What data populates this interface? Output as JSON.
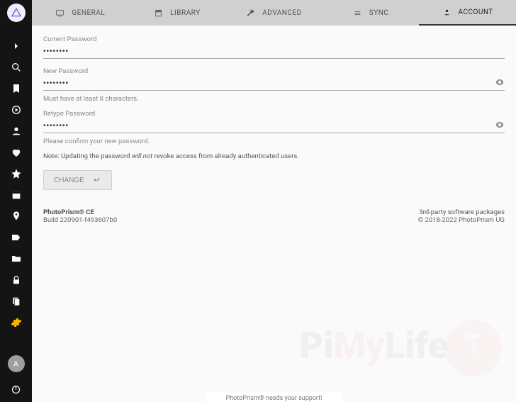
{
  "sidebar": {
    "items": [
      {
        "name": "expand-icon"
      },
      {
        "name": "search-icon"
      },
      {
        "name": "bookmark-icon"
      },
      {
        "name": "play-icon"
      },
      {
        "name": "person-icon"
      },
      {
        "name": "heart-icon"
      },
      {
        "name": "star-icon"
      },
      {
        "name": "calendar-icon"
      },
      {
        "name": "place-icon"
      },
      {
        "name": "label-icon"
      },
      {
        "name": "folder-icon"
      },
      {
        "name": "lock-icon"
      },
      {
        "name": "library-icon"
      },
      {
        "name": "settings-icon"
      }
    ],
    "avatar_initial": "A"
  },
  "tabs": [
    {
      "label": "GENERAL",
      "icon": "display-icon"
    },
    {
      "label": "LIBRARY",
      "icon": "archive-icon"
    },
    {
      "label": "ADVANCED",
      "icon": "wrench-icon"
    },
    {
      "label": "SYNC",
      "icon": "sync-icon"
    },
    {
      "label": "ACCOUNT",
      "icon": "account-icon",
      "active": true
    }
  ],
  "form": {
    "current_label": "Current Password",
    "current_value": "••••••••",
    "new_label": "New Password",
    "new_value": "••••••••",
    "new_hint": "Must have at least 8 characters.",
    "retype_label": "Retype Password",
    "retype_value": "••••••••",
    "retype_hint": "Please confirm your new password.",
    "note_prefix": "Note: Updating the password ",
    "note_em": "will not",
    "note_suffix": " revoke access from already authenticated users.",
    "change_label": "CHANGE"
  },
  "footer": {
    "brand": "PhotoPrism® CE",
    "build": "Build 220901-f493607b0",
    "packages_link": "3rd-party software packages",
    "copyright": "© 2018-2022 PhotoPrism UG"
  },
  "support": "PhotoPrism® needs your support!"
}
